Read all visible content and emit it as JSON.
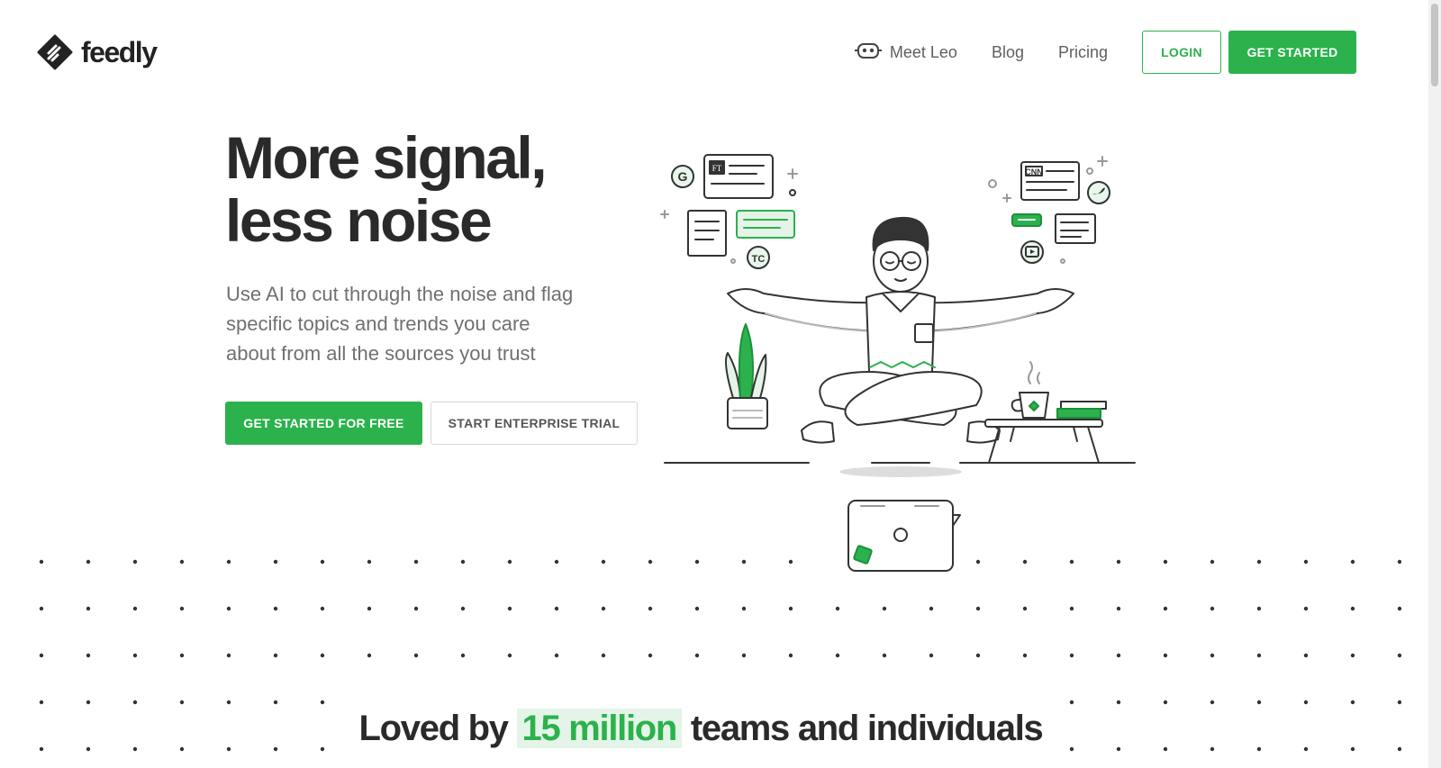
{
  "brand": {
    "name": "feedly"
  },
  "nav": {
    "meet_leo": "Meet Leo",
    "blog": "Blog",
    "pricing": "Pricing",
    "login": "LOGIN",
    "get_started": "GET STARTED"
  },
  "hero": {
    "title_line1": "More signal,",
    "title_line2": "less noise",
    "subtitle_line1": "Use AI to cut through the noise and flag",
    "subtitle_line2": "specific topics and trends you care",
    "subtitle_line3": "about from all the sources you trust",
    "primary_cta": "GET STARTED FOR FREE",
    "secondary_cta": "START ENTERPRISE TRIAL"
  },
  "illustration": {
    "badge_ft": "FT",
    "badge_cnn": "CNN",
    "badge_google": "G",
    "badge_tc": "TC"
  },
  "social_proof": {
    "prefix": "Loved by",
    "highlight": "15 million",
    "suffix": "teams and individuals"
  },
  "colors": {
    "accent": "#2bb24c",
    "accent_light": "#e5f4e8",
    "heading": "#2a2a2a",
    "body_text": "#707070"
  }
}
